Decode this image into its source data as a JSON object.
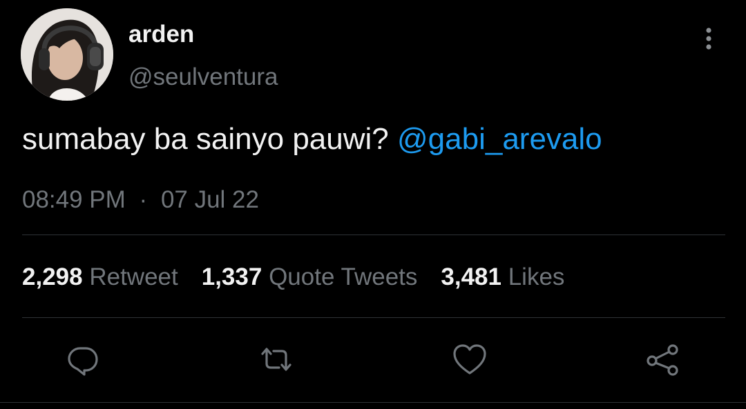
{
  "user": {
    "display_name": "arden",
    "handle": "@seulventura"
  },
  "tweet": {
    "text": "sumabay ba sainyo pauwi? ",
    "mention": "@gabi_arevalo",
    "time": "08:49 PM",
    "separator": "·",
    "date": "07 Jul 22"
  },
  "stats": {
    "retweets": {
      "count": "2,298",
      "label": "Retweet"
    },
    "quotes": {
      "count": "1,337",
      "label": "Quote Tweets"
    },
    "likes": {
      "count": "3,481",
      "label": "Likes"
    }
  },
  "icons": {
    "more": "more-vertical-icon",
    "reply": "reply-icon",
    "retweet": "retweet-icon",
    "like": "heart-icon",
    "share": "share-icon"
  },
  "colors": {
    "background": "#000000",
    "text": "#f2f2f2",
    "secondary": "#71767b",
    "accent": "#1d9bf0",
    "divider": "#2f3336"
  }
}
